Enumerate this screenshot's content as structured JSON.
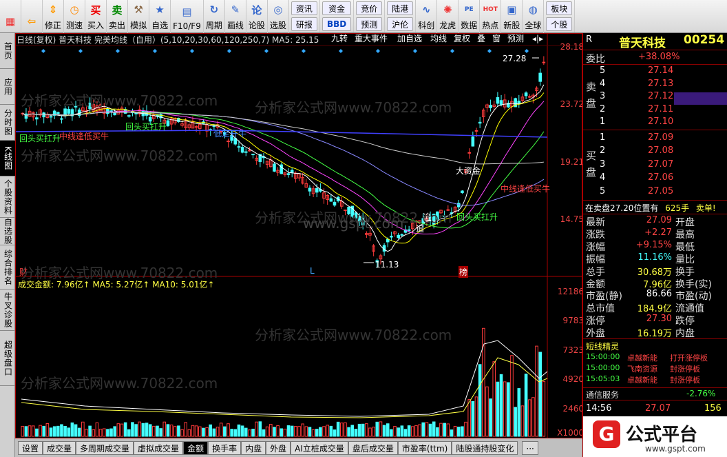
{
  "toolbar": {
    "buttons": [
      {
        "label": "",
        "icon": "grid-icon"
      },
      {
        "label": "",
        "icon": "back-arrow-icon"
      },
      {
        "label": "修正",
        "icon": "up-down-icon"
      },
      {
        "label": "测速",
        "icon": "clock-icon"
      },
      {
        "label": "买入",
        "icon": "buy-icon",
        "glyph": "买"
      },
      {
        "label": "卖出",
        "icon": "sell-icon",
        "glyph": "卖"
      },
      {
        "label": "模拟",
        "icon": "hammer-icon"
      },
      {
        "label": "自选",
        "icon": "star-icon"
      },
      {
        "label": "F10/F9",
        "icon": "f10-icon"
      },
      {
        "label": "周期",
        "icon": "cycle-icon"
      },
      {
        "label": "画线",
        "icon": "pencil-icon"
      },
      {
        "label": "论股",
        "icon": "talk-icon",
        "glyph": "论"
      },
      {
        "label": "选股",
        "icon": "select-icon"
      }
    ],
    "small_buttons": [
      [
        "资讯",
        "研报"
      ],
      [
        "资金",
        "BBD"
      ],
      [
        "竞价",
        "预测"
      ],
      [
        "陆港",
        "沪伦"
      ]
    ],
    "buttons2": [
      {
        "label": "科创",
        "icon": "tech-icon"
      },
      {
        "label": "龙虎",
        "icon": "dragon-icon"
      },
      {
        "label": "数据",
        "icon": "data-icon",
        "glyph": "PE"
      },
      {
        "label": "热点",
        "icon": "hot-icon",
        "glyph": "HOT"
      },
      {
        "label": "新股",
        "icon": "ipo-icon"
      },
      {
        "label": "全球",
        "icon": "globe-icon"
      }
    ],
    "right_small": [
      "板块",
      "个股"
    ]
  },
  "lefttabs": [
    "首页",
    "应用",
    "分时图",
    "K线图",
    "个股资料",
    "自选股",
    "综合排名",
    "牛叉诊股",
    "超级盘口"
  ],
  "chart": {
    "header_text": "日线(复权) 普天科技 完美均线（自用）(5,10,20,30,60,120,250,7) MA5: 25.15",
    "header_buttons": [
      "九转",
      "重大事件",
      "加自选",
      "均线",
      "复权",
      "叠",
      "窗",
      "预测"
    ],
    "price_axis": [
      "28.18",
      "23.72",
      "19.21",
      "14.75"
    ],
    "volume_axis": [
      "12186",
      "9783",
      "7323",
      "4920",
      "2460",
      "X1000"
    ],
    "volume_header": "成交金额: 7.96亿↑ MA5: 5.27亿↑ MA10: 5.01亿↑",
    "annotations": {
      "high": "27.28",
      "low": "11.13",
      "a1": "回头买扛升",
      "a2": "中线逢低买牛",
      "a3": "回头买扛升",
      "a4": "低定开牛",
      "a5": "大资金",
      "a6": "中线逢低买牛",
      "a7": "回头买扛升",
      "a8": "追",
      "a9": "追",
      "cai": "财",
      "L": "L",
      "bang": "榜"
    },
    "watermark": "分析家公式网www.70822.com",
    "watermark2": "www.gspt.com",
    "colors": {
      "up": "#ff3b3b",
      "down": "#44ffff",
      "ma5": "#ffffff",
      "ma10": "#ffff00",
      "ma20": "#ff44ff",
      "ma30": "#44ff44",
      "ma60": "#8888ff",
      "ma120": "#cccccc",
      "ma250": "#4040ff"
    }
  },
  "bottomtabs": [
    "设置",
    "成交量",
    "多周期成交量",
    "虚拟成交量",
    "金额",
    "换手率",
    "内盘",
    "外盘",
    "AI立桩成交量",
    "盘后成交量",
    "市盈率(ttm)",
    "陆股通持股变化"
  ],
  "bottom_active": "金额",
  "right": {
    "symbol": "R",
    "name": "普天科技",
    "code": "00254",
    "weibi_label": "委比",
    "weibi": "+38.08%",
    "sell_label": "卖盘",
    "buy_label": "买盘",
    "sell": [
      {
        "n": "5",
        "p": "27.14"
      },
      {
        "n": "4",
        "p": "27.13"
      },
      {
        "n": "3",
        "p": "27.12"
      },
      {
        "n": "2",
        "p": "27.11"
      },
      {
        "n": "1",
        "p": "27.10"
      }
    ],
    "buy": [
      {
        "n": "1",
        "p": "27.09"
      },
      {
        "n": "2",
        "p": "27.08"
      },
      {
        "n": "3",
        "p": "27.07"
      },
      {
        "n": "4",
        "p": "27.06"
      },
      {
        "n": "5",
        "p": "27.05"
      }
    ],
    "status_text": "在卖盘27.20位置有",
    "status_vol": "625手",
    "status_tag": "卖单!",
    "stats": [
      {
        "l": "最新",
        "v": "27.09",
        "r": "开盘",
        "c": "red"
      },
      {
        "l": "涨跌",
        "v": "+2.27",
        "r": "最高",
        "c": "red"
      },
      {
        "l": "涨幅",
        "v": "+9.15%",
        "r": "最低",
        "c": "red"
      },
      {
        "l": "振幅",
        "v": "11.16%",
        "r": "量比",
        "c": "cyan"
      },
      {
        "l": "总手",
        "v": "30.68万",
        "r": "换手",
        "c": "yellow"
      },
      {
        "l": "金额",
        "v": "7.96亿",
        "r": "换手(实)",
        "c": "yellow"
      },
      {
        "l": "市盈(静)",
        "v": "86.66",
        "r": "市盈(动)",
        "c": "white"
      },
      {
        "l": "总市值",
        "v": "184.9亿",
        "r": "流通值",
        "c": "yellow"
      },
      {
        "l": "涨停",
        "v": "27.30",
        "r": "跌停",
        "c": "red"
      },
      {
        "l": "外盘",
        "v": "16.19万",
        "r": "内盘",
        "c": "yellow"
      }
    ],
    "sprite_title": "短线精灵",
    "sprites": [
      {
        "t": "15:00:00",
        "n": "卓越新能",
        "e": "打开涨停板"
      },
      {
        "t": "15:00:00",
        "n": "飞南资源",
        "e": "封涨停板"
      },
      {
        "t": "15:05:03",
        "n": "卓越新能",
        "e": "封涨停板"
      }
    ],
    "service_label": "通信服务",
    "service_pct": "-2.76%",
    "tick": {
      "time": "14:56",
      "price": "27.07",
      "vol": "156"
    },
    "logo_text": "公式平台",
    "logo_url": "www.gspt.com"
  }
}
